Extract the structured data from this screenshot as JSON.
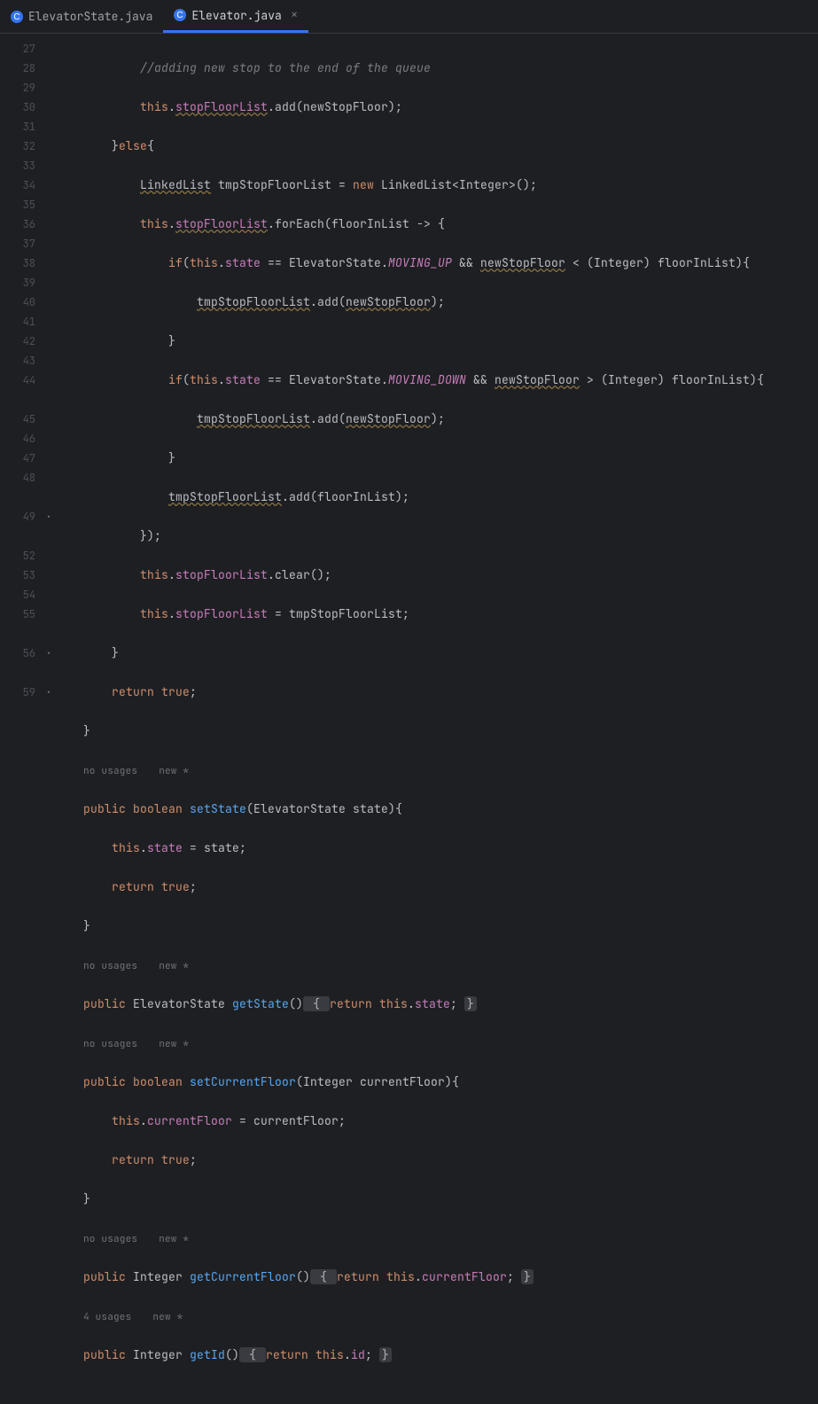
{
  "tabs": [
    {
      "label": "ElevatorState.java",
      "icon_color": "#3574f0",
      "icon_letter": "C"
    },
    {
      "label": "Elevator.java",
      "icon_color": "#3574f0",
      "icon_letter": "C"
    }
  ],
  "close_icon_char": "×",
  "gutter": {
    "lines": [
      "27",
      "28",
      "29",
      "30",
      "31",
      "32",
      "33",
      "34",
      "35",
      "36",
      "37",
      "38",
      "39",
      "40",
      "41",
      "42",
      "43",
      "44",
      "",
      "45",
      "46",
      "47",
      "48",
      "",
      "49",
      "",
      "52",
      "53",
      "54",
      "55",
      "",
      "56",
      "",
      "59"
    ],
    "fold_lines": [
      "49",
      "56",
      "59"
    ]
  },
  "hints": {
    "no_usages": "no usages",
    "new": "new *",
    "four_usages": "4 usages"
  },
  "code": {
    "l27": "//adding new stop to the end of the queue",
    "l28": {
      "a": "this",
      "b": ".",
      "c": "stopFloorList",
      "d": ".add(newStopFloor);"
    },
    "l29": {
      "a": "}",
      "b": "else",
      "c": "{"
    },
    "l30": {
      "a": "LinkedList",
      "b": " tmpStopFloorList = ",
      "c": "new",
      "d": " LinkedList<Integer>();"
    },
    "l31": {
      "a": "this",
      "b": ".",
      "c": "stopFloorList",
      "d": ".forEach(floorInList -> {"
    },
    "l32": {
      "a": "if",
      "b": "(",
      "c": "this",
      "d": ".",
      "e": "state",
      "f": " == ElevatorState.",
      "g": "MOVING_UP",
      "h": " && ",
      "i": "newStopFloor",
      "j": " < (Integer) floorInList){"
    },
    "l33": {
      "a": "tmpStopFloorList",
      "b": ".add(",
      "c": "newStopFloor",
      "d": ");"
    },
    "l34": "}",
    "l35": {
      "a": "if",
      "b": "(",
      "c": "this",
      "d": ".",
      "e": "state",
      "f": " == ElevatorState.",
      "g": "MOVING_DOWN",
      "h": " && ",
      "i": "newStopFloor",
      "j": " > (Integer) floorInList){"
    },
    "l36": {
      "a": "tmpStopFloorList",
      "b": ".add(",
      "c": "newStopFloor",
      "d": ");"
    },
    "l37": "}",
    "l38": {
      "a": "tmpStopFloorList",
      "b": ".add(floorInList);"
    },
    "l39": "});",
    "l40": {
      "a": "this",
      "b": ".",
      "c": "stopFloorList",
      "d": ".clear();"
    },
    "l41": {
      "a": "this",
      "b": ".",
      "c": "stopFloorList",
      "d": " = tmpStopFloorList;"
    },
    "l42": "}",
    "l43": {
      "a": "return ",
      "b": "true",
      "c": ";"
    },
    "l44": "}",
    "l45": {
      "a": "public ",
      "b": "boolean ",
      "c": "setState",
      "d": "(ElevatorState state){"
    },
    "l46": {
      "a": "this",
      "b": ".",
      "c": "state",
      "d": " = state;"
    },
    "l47": {
      "a": "return ",
      "b": "true",
      "c": ";"
    },
    "l48": "}",
    "l49": {
      "a": "public ",
      "b": "ElevatorState ",
      "c": "getState",
      "d": "()",
      "e": " { ",
      "f": "return ",
      "g": "this",
      "h": ".",
      "i": "state",
      "j": "; ",
      "k": "}"
    },
    "l52": {
      "a": "public ",
      "b": "boolean ",
      "c": "setCurrentFloor",
      "d": "(Integer currentFloor){"
    },
    "l53": {
      "a": "this",
      "b": ".",
      "c": "currentFloor",
      "d": " = currentFloor;"
    },
    "l54": {
      "a": "return ",
      "b": "true",
      "c": ";"
    },
    "l55": "}",
    "l56": {
      "a": "public ",
      "b": "Integer ",
      "c": "getCurrentFloor",
      "d": "()",
      "e": " { ",
      "f": "return ",
      "g": "this",
      "h": ".",
      "i": "currentFloor",
      "j": "; ",
      "k": "}"
    },
    "l59": {
      "a": "public ",
      "b": "Integer ",
      "c": "getId",
      "d": "()",
      "e": " { ",
      "f": "return ",
      "g": "this",
      "h": ".",
      "i": "id",
      "j": "; ",
      "k": "}"
    }
  }
}
